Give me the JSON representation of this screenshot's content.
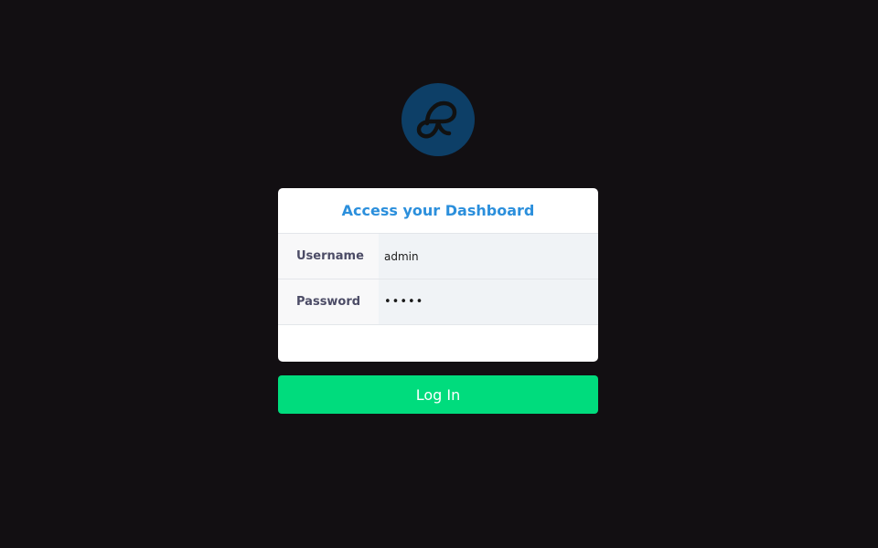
{
  "logo": {
    "icon": "brand-loop-icon",
    "background_color": "#0d3f67",
    "glyph_color": "#111111"
  },
  "login_card": {
    "title": "Access your Dashboard",
    "title_color": "#2b8fdc",
    "fields": [
      {
        "label": "Username",
        "value": "admin",
        "type": "text"
      },
      {
        "label": "Password",
        "value": "•••••",
        "type": "password"
      }
    ]
  },
  "login_button": {
    "label": "Log In",
    "color": "#00dc7d"
  }
}
